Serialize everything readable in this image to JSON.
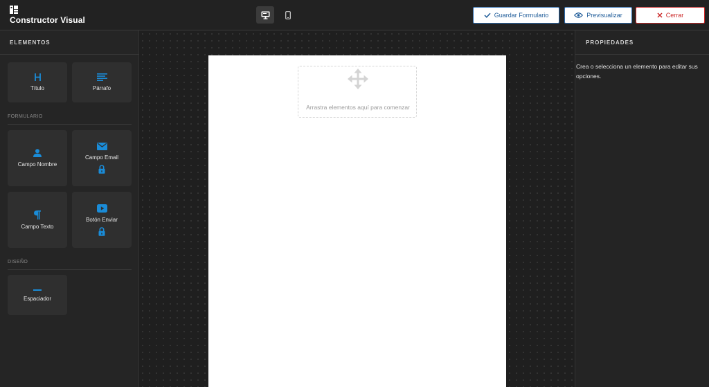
{
  "app": {
    "title": "Constructor Visual",
    "logo_icon": "builder-logo-icon"
  },
  "header": {
    "view_toggles": [
      {
        "name": "desktop-view",
        "icon": "monitor-icon",
        "active": true
      },
      {
        "name": "mobile-view",
        "icon": "phone-icon",
        "active": false
      }
    ],
    "save_label": "Guardar Formulario",
    "preview_label": "Previsualizar",
    "close_label": "Cerrar",
    "accent_color": "#2f6fb3",
    "danger_color": "#cc2a2a"
  },
  "sidebar": {
    "heading": "ELEMENTOS",
    "basic_items": [
      {
        "label": "Título",
        "icon": "heading-icon",
        "locked": false
      },
      {
        "label": "Párrafo",
        "icon": "paragraph-lines-icon",
        "locked": false
      }
    ],
    "sections": [
      {
        "title": "FORMULARIO",
        "items": [
          {
            "label": "Campo Nombre",
            "icon": "user-icon",
            "locked": false
          },
          {
            "label": "Campo Email",
            "icon": "envelope-icon",
            "locked": true
          },
          {
            "label": "Campo Texto",
            "icon": "pilcrow-icon",
            "locked": false
          },
          {
            "label": "Botón Enviar",
            "icon": "play-button-icon",
            "locked": true
          }
        ]
      },
      {
        "title": "DISEÑO",
        "items": [
          {
            "label": "Espaciador",
            "icon": "spacer-icon",
            "locked": false
          }
        ]
      }
    ],
    "icon_color": "#1a8cd8"
  },
  "canvas": {
    "dropzone_text": "Arrastra elementos aquí para comenzar",
    "dropzone_icon": "move-arrows-icon"
  },
  "properties": {
    "heading": "PROPIEDADES",
    "empty_text": "Crea o selecciona un elemento para editar sus opciones."
  }
}
